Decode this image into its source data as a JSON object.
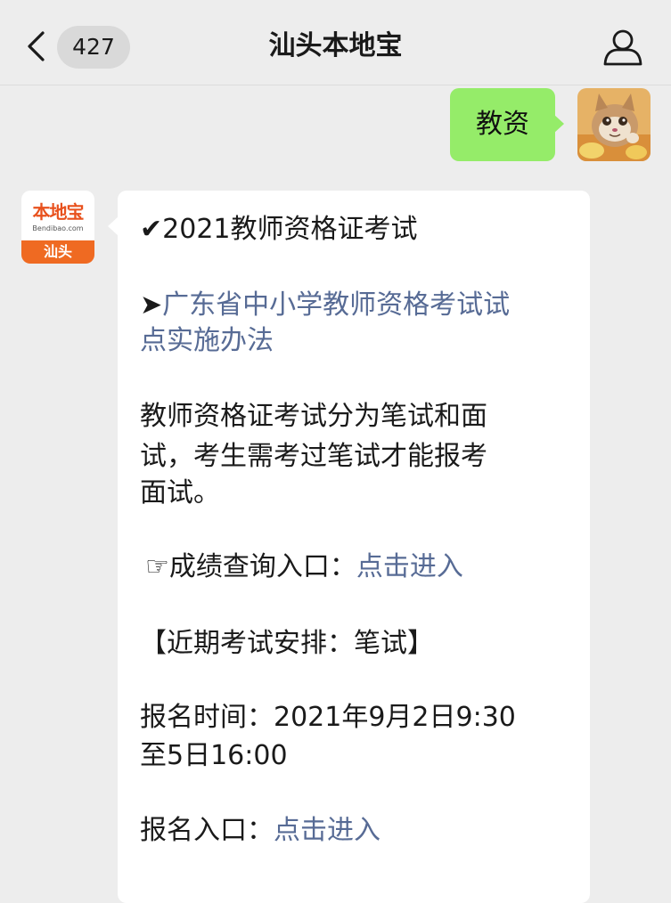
{
  "header": {
    "title": "汕头本地宝",
    "unread_count": "427",
    "back_icon": "chevron-left-icon",
    "profile_icon": "person-icon"
  },
  "sent_message": {
    "text": "教资",
    "bubble_color": "#95ec69"
  },
  "bot_avatar": {
    "logo_text": "本地宝",
    "logo_domain": "Bendibao.com",
    "city": "汕头"
  },
  "message": {
    "title_mark": "✔",
    "title": "2021教师资格证考试",
    "link1_arrow": "➤",
    "link1_line1": "广东省中小学教师资格考试试",
    "link1_line2": "点实施办法",
    "para_line1": "教师资格证考试分为笔试和面",
    "para_line2": "试，考生需考过笔试才能报考",
    "para_line3": "面试。",
    "score_pointer": "☞",
    "score_label": "成绩查询入口：",
    "score_link": "点击进入",
    "schedule_heading": "【近期考试安排：笔试】",
    "reg_time_line1": "报名时间：2021年9月2日9:30",
    "reg_time_line2": "至5日16:00",
    "reg_entry_label": "报名入口：",
    "reg_entry_link": "点击进入",
    "link_color": "#576b95"
  }
}
